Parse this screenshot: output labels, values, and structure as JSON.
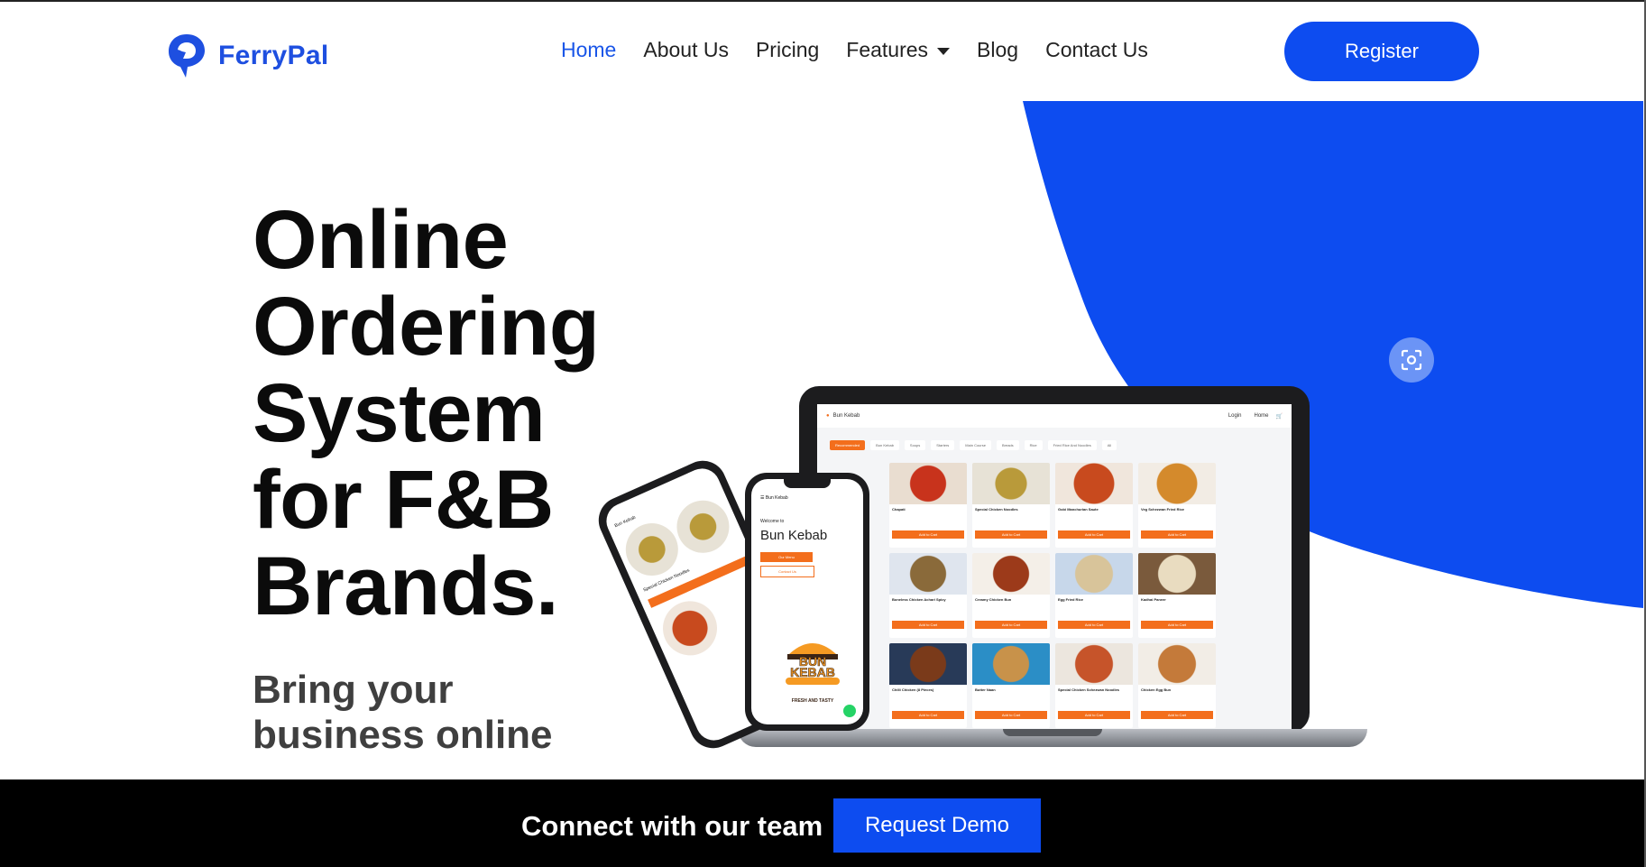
{
  "brand": {
    "name": "FerryPal",
    "accent": "#0d4cf0"
  },
  "nav": {
    "items": [
      {
        "label": "Home",
        "active": true
      },
      {
        "label": "About Us"
      },
      {
        "label": "Pricing"
      },
      {
        "label": "Features",
        "dropdown": true
      },
      {
        "label": "Blog"
      },
      {
        "label": "Contact Us"
      }
    ],
    "register_label": "Register"
  },
  "hero": {
    "headline_lines": [
      "Online",
      "Ordering",
      "System",
      "for F&B",
      "Brands."
    ],
    "subline_lines": [
      "Bring your",
      "business online"
    ]
  },
  "mockup": {
    "laptop_brand": "Bun Kebab",
    "laptop_nav": [
      "Login",
      "Home"
    ],
    "tabs": [
      "Recommended",
      "Bun Kebab",
      "Soups",
      "Starters",
      "Main Course",
      "Breads",
      "Rice",
      "Fried Rice And Noodles",
      "All"
    ],
    "items": [
      "Chapati",
      "Special Chicken Noodles",
      "Gobi Manchurian Saute",
      "Veg Schezwan Fried Rice",
      "Boneless Chicken Achari Spicy",
      "Creamy Chicken Bun",
      "Egg Fried Rice",
      "Kadhai Paneer",
      "Chilli Chicken (8 Pieces)",
      "Butter Naan",
      "Special Chicken Schezwan Noodles",
      "Chicken Egg Bun"
    ],
    "add_label": "Add to Cart",
    "phone_header": "Bun Kebab",
    "phone_welcome": "Welcome to",
    "phone_title": "Bun Kebab",
    "phone_btn1": "Our Menu",
    "phone_btn2": "Contact Us",
    "logo_line1": "BUN",
    "logo_line2": "KEBAB",
    "logo_tagline": "FRESH AND TASTY",
    "phone1_item": "Special Chicken Noodles"
  },
  "cta": {
    "text": "Connect with our team",
    "button_label": "Request Demo"
  },
  "icons": [
    "ferrypal-logo-icon",
    "caret-down-icon",
    "scan-icon",
    "cart-icon",
    "whatsapp-icon"
  ]
}
